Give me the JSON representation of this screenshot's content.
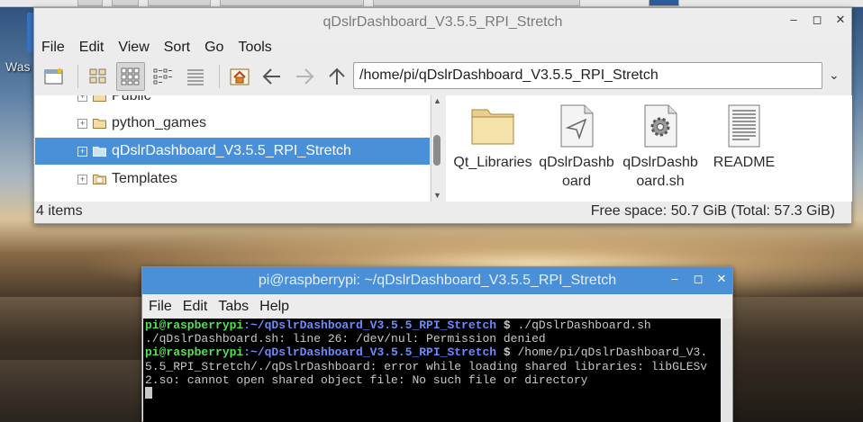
{
  "desktop": {
    "icon_label_fragment": "Was"
  },
  "file_manager": {
    "title": "qDslrDashboard_V3.5.5_RPI_Stretch",
    "window_controls": {
      "minimize": "–",
      "maximize": "◻",
      "close": "✕"
    },
    "menu": [
      "File",
      "Edit",
      "View",
      "Sort",
      "Go",
      "Tools"
    ],
    "path": "/home/pi/qDslrDashboard_V3.5.5_RPI_Stretch",
    "tree": [
      {
        "label": "Public",
        "expander": "+",
        "selected": false
      },
      {
        "label": "python_games",
        "expander": "+",
        "selected": false
      },
      {
        "label": "qDslrDashboard_V3.5.5_RPI_Stretch",
        "expander": "+",
        "selected": true
      },
      {
        "label": "Templates",
        "expander": "+",
        "selected": false
      }
    ],
    "files": [
      {
        "label": "Qt_Libraries",
        "icon": "folder-icon"
      },
      {
        "label": "qDslrDashboard",
        "icon": "executable-icon"
      },
      {
        "label": "qDslrDashboard.sh",
        "icon": "script-gear-icon"
      },
      {
        "label": "README",
        "icon": "text-document-icon"
      }
    ],
    "status_left": "4 items",
    "status_right": "Free space: 50.7 GiB (Total: 57.3 GiB)"
  },
  "terminal": {
    "title": "pi@raspberrypi: ~/qDslrDashboard_V3.5.5_RPI_Stretch",
    "window_controls": {
      "minimize": "–",
      "maximize": "◻",
      "close": "✕"
    },
    "menu": [
      "File",
      "Edit",
      "Tabs",
      "Help"
    ],
    "prompt_user": "pi@raspberrypi",
    "prompt_path": ":~/qDslrDashboard_V3.5.5_RPI_Stretch",
    "prompt_symbol": " $",
    "cmd1": " ./qDslrDashboard.sh",
    "out1": "./qDslrDashboard.sh: line 26: /dev/nul: Permission denied",
    "cmd2": " /home/pi/qDslrDashboard_V3.",
    "out2a": "5.5_RPI_Stretch/./qDslrDashboard: error while loading shared libraries: libGLESv",
    "out2b": "2.so: cannot open shared object file: No such file or directory"
  },
  "colors": {
    "selection": "#4a90d9",
    "prompt_user": "#55e055",
    "prompt_path": "#6b8cff"
  }
}
